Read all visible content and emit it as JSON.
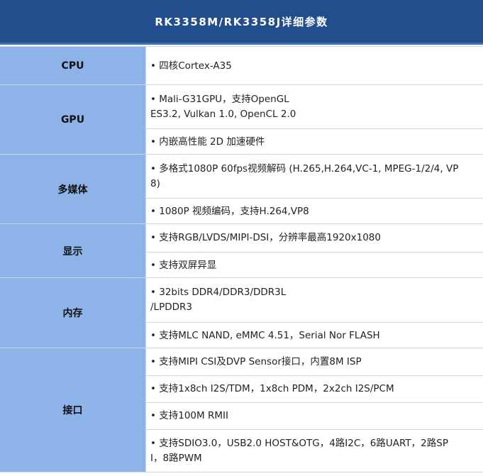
{
  "title": "RK3358M/RK3358J详细参数",
  "sections": [
    {
      "label": "CPU",
      "items": [
        "• 四核Cortex-A35"
      ]
    },
    {
      "label": "GPU",
      "items": [
        "• Mali-G31GPU，支持OpenGL\nES3.2, Vulkan 1.0, OpenCL 2.0",
        "• 内嵌高性能 2D 加速硬件"
      ]
    },
    {
      "label": "多媒体",
      "items": [
        "• 多格式1080P 60fps视频解码 (H.265,H.264,VC-1, MPEG-1/2/4, VP\n8)",
        "• 1080P 视频编码，支持H.264,VP8"
      ]
    },
    {
      "label": "显示",
      "items": [
        "• 支持RGB/LVDS/MIPI-DSI，分辨率最高1920x1080",
        "• 支持双屏异显"
      ]
    },
    {
      "label": "内存",
      "items": [
        "• 32bits DDR4/DDR3/DDR3L\n/LPDDR3",
        "• 支持MLC NAND, eMMC 4.51，Serial Nor FLASH"
      ]
    },
    {
      "label": "接口",
      "items": [
        "• 支持MIPI CSI及DVP Sensor接口，内置8M ISP",
        "• 支持1x8ch I2S/TDM，1x8ch PDM，2x2ch I2S/PCM",
        "• 支持100M RMII",
        "• 支持SDIO3.0，USB2.0 HOST&OTG，4路I2C，6路UART，2路SP\nI，8路PWM"
      ]
    }
  ]
}
